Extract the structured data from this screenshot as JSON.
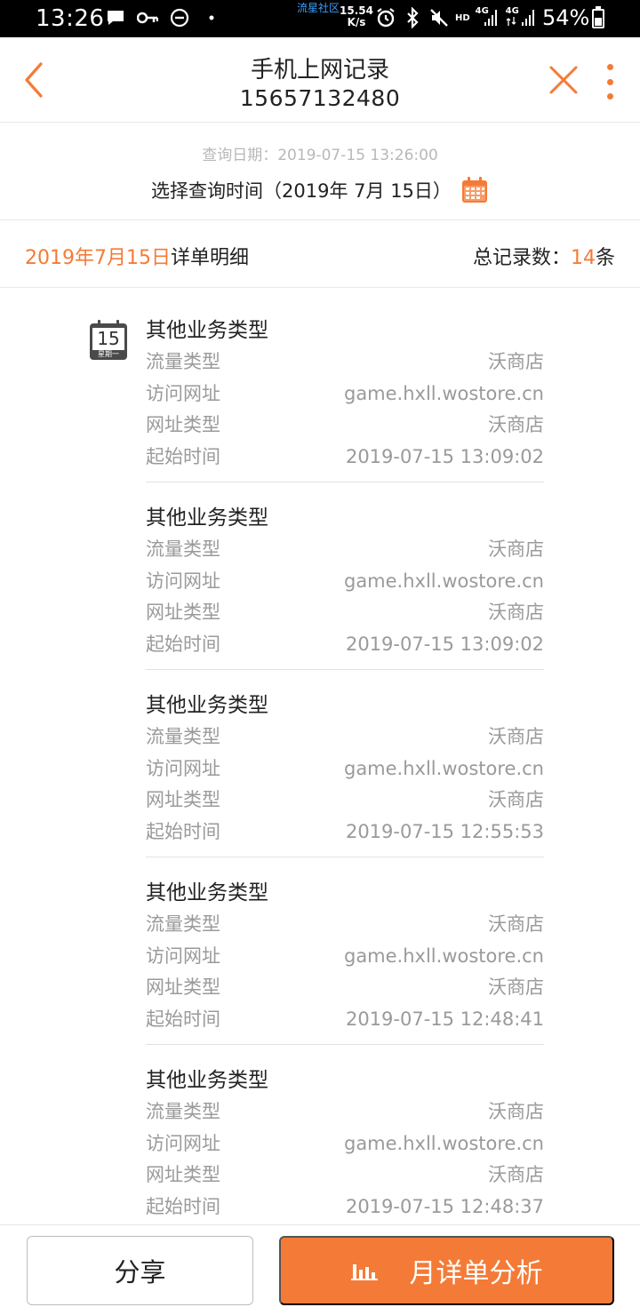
{
  "status_bar": {
    "time": "13:26",
    "community": "流星社区",
    "speed_value": "15.54",
    "speed_unit": "K/s",
    "hd": "HD",
    "net1": "4G",
    "net2": "4G",
    "battery": "54%"
  },
  "header": {
    "title": "手机上网记录",
    "phone": "15657132480"
  },
  "query": {
    "date_label": "查询日期：2019-07-15 13:26:00",
    "select_label": "选择查询时间（2019年 7月 15日）"
  },
  "summary": {
    "date": "2019年7月15日",
    "detail_label": "详单明细",
    "total_label": "总记录数：",
    "total_count": "14",
    "total_unit": "条"
  },
  "badge": {
    "day": "15",
    "weekday": "星期一"
  },
  "records": [
    {
      "title": "其他业务类型",
      "rows": [
        {
          "label": "流量类型",
          "value": "沃商店"
        },
        {
          "label": "访问网址",
          "value": "game.hxll.wostore.cn"
        },
        {
          "label": "网址类型",
          "value": "沃商店"
        },
        {
          "label": "起始时间",
          "value": "2019-07-15 13:09:02"
        }
      ]
    },
    {
      "title": "其他业务类型",
      "rows": [
        {
          "label": "流量类型",
          "value": "沃商店"
        },
        {
          "label": "访问网址",
          "value": "game.hxll.wostore.cn"
        },
        {
          "label": "网址类型",
          "value": "沃商店"
        },
        {
          "label": "起始时间",
          "value": "2019-07-15 13:09:02"
        }
      ]
    },
    {
      "title": "其他业务类型",
      "rows": [
        {
          "label": "流量类型",
          "value": "沃商店"
        },
        {
          "label": "访问网址",
          "value": "game.hxll.wostore.cn"
        },
        {
          "label": "网址类型",
          "value": "沃商店"
        },
        {
          "label": "起始时间",
          "value": "2019-07-15 12:55:53"
        }
      ]
    },
    {
      "title": "其他业务类型",
      "rows": [
        {
          "label": "流量类型",
          "value": "沃商店"
        },
        {
          "label": "访问网址",
          "value": "game.hxll.wostore.cn"
        },
        {
          "label": "网址类型",
          "value": "沃商店"
        },
        {
          "label": "起始时间",
          "value": "2019-07-15 12:48:41"
        }
      ]
    },
    {
      "title": "其他业务类型",
      "rows": [
        {
          "label": "流量类型",
          "value": "沃商店"
        },
        {
          "label": "访问网址",
          "value": "game.hxll.wostore.cn"
        },
        {
          "label": "网址类型",
          "value": "沃商店"
        },
        {
          "label": "起始时间",
          "value": "2019-07-15 12:48:37"
        }
      ]
    }
  ],
  "bottom": {
    "share_label": "分享",
    "analysis_label": "月详单分析"
  },
  "colors": {
    "accent": "#f47b37",
    "muted_text": "#9a9a9a"
  }
}
